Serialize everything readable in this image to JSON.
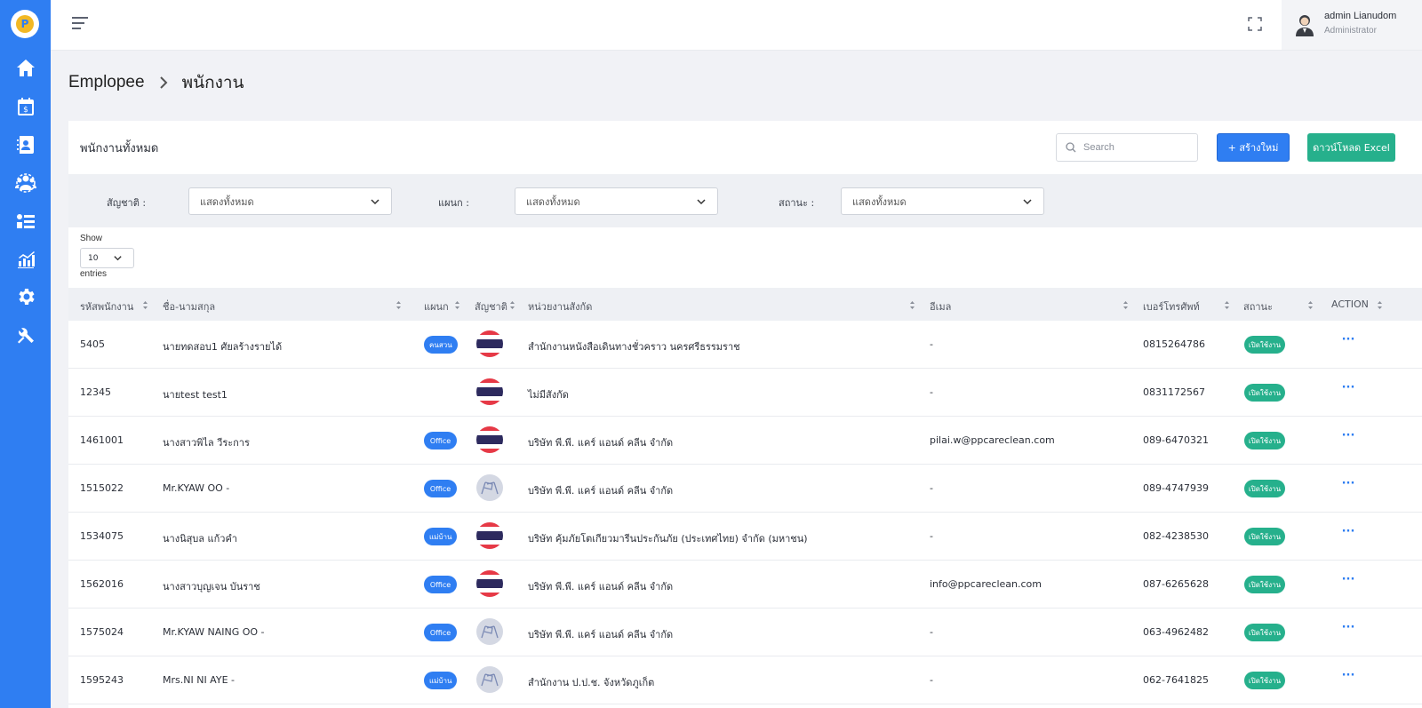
{
  "sidebar": {
    "logo_text": "P",
    "items": [
      {
        "icon": "home-icon"
      },
      {
        "icon": "calendar-money-icon"
      },
      {
        "icon": "contact-book-icon"
      },
      {
        "icon": "employees-group-icon"
      },
      {
        "icon": "list-icon"
      },
      {
        "icon": "chart-icon"
      },
      {
        "icon": "settings-icon"
      },
      {
        "icon": "tools-icon"
      }
    ],
    "color": "#2f7ef2"
  },
  "topbar": {
    "user_name": "admin Lianudom",
    "user_role": "Administrator"
  },
  "breadcrumb": {
    "parent": "Emplopee",
    "current": "พนักงาน"
  },
  "card": {
    "title": "พนักงานทั้งหมด",
    "search_placeholder": "Search",
    "create_label": "+  สร้างใหม่",
    "excel_label": "ดาวน์โหลด Excel"
  },
  "filters": {
    "nationality_label": "สัญชาติ :",
    "nationality_value": "แสดงทั้งหมด",
    "department_label": "แผนก :",
    "department_value": "แสดงทั้งหมด",
    "status_label": "สถานะ :",
    "status_value": "แสดงทั้งหมด"
  },
  "pagination": {
    "show_label": "Show",
    "page_size": "10",
    "entries_label": "entries"
  },
  "table": {
    "headers": {
      "id": "รหัสพนักงาน",
      "name": "ชื่อ-นามสกุล",
      "department": "แผนก",
      "nationality": "สัญชาติ",
      "unit": "หน่วยงานสังกัด",
      "email": "อีเมล",
      "phone": "เบอร์โทรศัพท์",
      "status": "สถานะ",
      "action": "ACTION"
    },
    "rows": [
      {
        "id": "5405",
        "name": "นายทดสอบ1 ศัยลร้างรายได้",
        "department": "คนสวน",
        "nationality": "thai",
        "unit": "สำนักงานหนังสือเดินทางชั่วคราว นครศรีธรรมราช",
        "email": "-",
        "phone": "0815264786",
        "status": "เปิดใช้งาน",
        "action": "···"
      },
      {
        "id": "12345",
        "name": "นายtest test1",
        "department": "",
        "nationality": "thai",
        "unit": "ไม่มีสังกัด",
        "email": "-",
        "phone": "0831172567",
        "status": "เปิดใช้งาน",
        "action": "···"
      },
      {
        "id": "1461001",
        "name": "นางสาวพิไล วีระการ",
        "department": "Office",
        "nationality": "thai",
        "unit": "บริษัท พี.พี. แคร์ แอนด์ คลีน จำกัด",
        "email": "pilai.w@ppcareclean.com",
        "phone": "089-6470321",
        "status": "เปิดใช้งาน",
        "action": "···"
      },
      {
        "id": "1515022",
        "name": "Mr.KYAW OO -",
        "department": "Office",
        "nationality": "myanmar",
        "unit": "บริษัท พี.พี. แคร์ แอนด์ คลีน จำกัด",
        "email": "-",
        "phone": "089-4747939",
        "status": "เปิดใช้งาน",
        "action": "···"
      },
      {
        "id": "1534075",
        "name": "นางนิสุบล แก้วคำ",
        "department": "แม่บ้าน",
        "nationality": "thai",
        "unit": "บริษัท คุ้มภัยโตเกียวมารีนประกันภัย (ประเทศไทย) จำกัด (มหาชน)",
        "email": "-",
        "phone": "082-4238530",
        "status": "เปิดใช้งาน",
        "action": "···"
      },
      {
        "id": "1562016",
        "name": "นางสาวบุญเจน บันราช",
        "department": "Office",
        "nationality": "thai",
        "unit": "บริษัท พี.พี. แคร์ แอนด์ คลีน จำกัด",
        "email": "info@ppcareclean.com",
        "phone": "087-6265628",
        "status": "เปิดใช้งาน",
        "action": "···"
      },
      {
        "id": "1575024",
        "name": "Mr.KYAW NAING OO -",
        "department": "Office",
        "nationality": "myanmar",
        "unit": "บริษัท พี.พี. แคร์ แอนด์ คลีน จำกัด",
        "email": "-",
        "phone": "063-4962482",
        "status": "เปิดใช้งาน",
        "action": "···"
      },
      {
        "id": "1595243",
        "name": "Mrs.NI NI AYE -",
        "department": "แม่บ้าน",
        "nationality": "myanmar",
        "unit": "สำนักงาน ป.ป.ช. จังหวัดภูเก็ต",
        "email": "-",
        "phone": "062-7641825",
        "status": "เปิดใช้งาน",
        "action": "···"
      }
    ]
  },
  "colors": {
    "primary": "#2f7ef2",
    "success": "#26b08c",
    "background": "#f1f2f6"
  }
}
